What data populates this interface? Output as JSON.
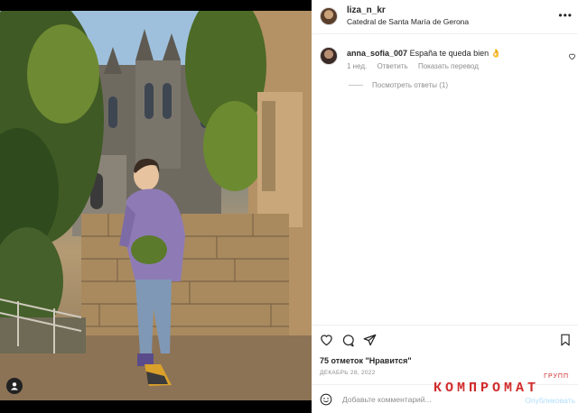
{
  "post": {
    "username": "liza_n_kr",
    "location": "Catedral de Santa María de Gerona",
    "more_label": "•••"
  },
  "comment": {
    "username": "anna_sofia_007",
    "text": "España te queda bien 👌",
    "age": "1 нед.",
    "reply_label": "Ответить",
    "translate_label": "Показать перевод",
    "view_replies": "Посмотреть ответы (1)"
  },
  "stats": {
    "likes": "75 отметок \"Нравится\"",
    "date": "ДЕКАБРЬ 28, 2022"
  },
  "composer": {
    "placeholder": "Добавьте комментарий...",
    "publish_label": "Опубликовать"
  },
  "watermark": {
    "main": "КОМПРОМАТ",
    "sub": "ГРУПП"
  },
  "icons": {
    "more": "more-options-icon",
    "heart": "heart-icon",
    "comment": "comment-icon",
    "share": "share-icon",
    "bookmark": "bookmark-icon",
    "emoji": "emoji-icon",
    "user_tag": "user-tag-icon"
  },
  "colors": {
    "text": "#262626",
    "muted": "#8e8e8e",
    "border": "#efefef",
    "publish": "#b2dffc",
    "watermark": "#d12a2a"
  }
}
